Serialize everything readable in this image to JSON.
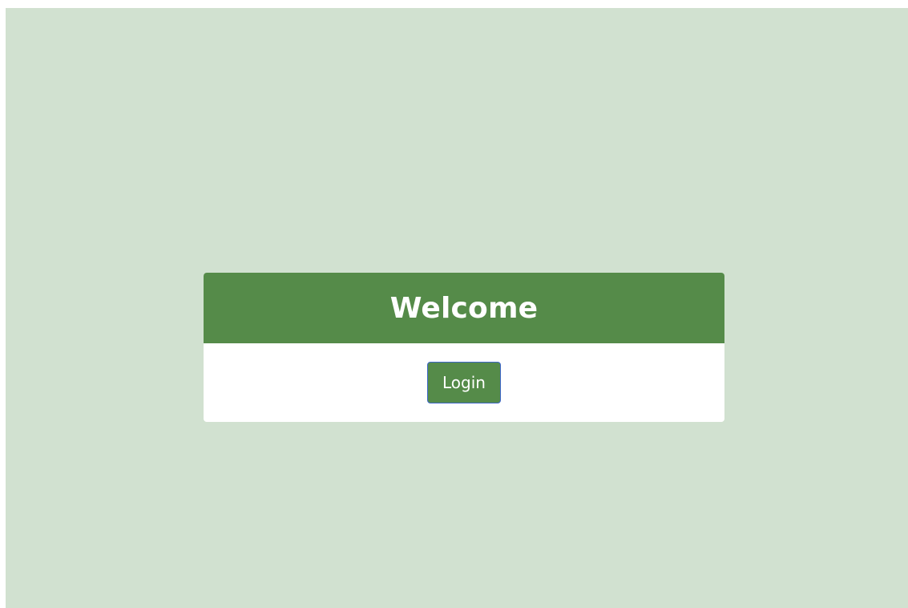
{
  "page": {
    "background_color": "#d1e1d0"
  },
  "card": {
    "title": "Welcome",
    "header_color": "#558b49",
    "login_label": "Login",
    "button_color": "#558b49",
    "button_border_color": "#3e66c9"
  }
}
